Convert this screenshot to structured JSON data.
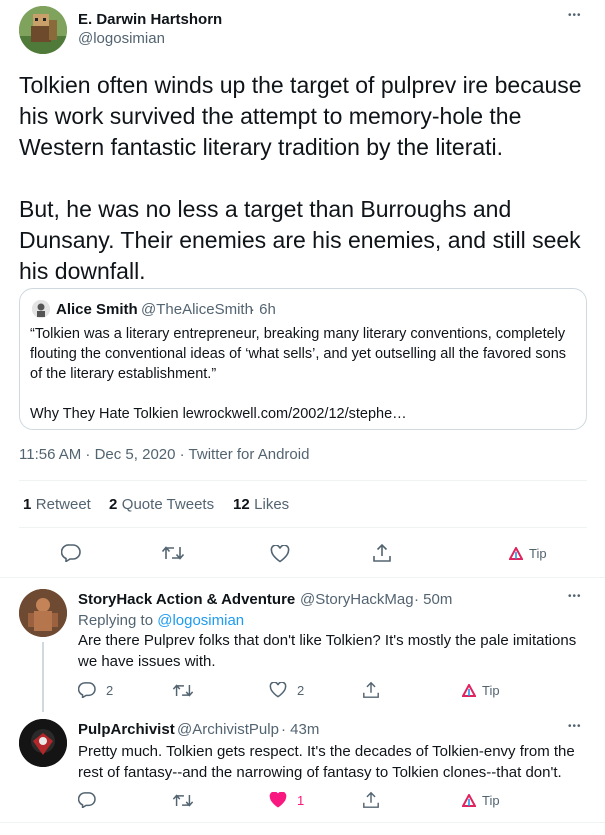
{
  "tweet": {
    "author_name": "E. Darwin Hartshorn",
    "author_handle": "@logosimian",
    "text": "Tolkien often winds up the target of pulprev ire because his work survived the attempt to memory-hole the Western fantastic literary tradition by the literati.\n\nBut, he was no less a target than Burroughs and Dunsany. Their enemies are his enemies, and still seek his downfall.",
    "more_glyph": "•••",
    "quote": {
      "name": "Alice Smith",
      "handle": "@TheAliceSmith",
      "time": "· 6h",
      "text": "“Tolkien was a literary entrepreneur, breaking many literary conventions, completely flouting the conventional ideas of ‘what sells’, and yet outselling all the favored sons of the literary establishment.”\n\nWhy They Hate Tolkien lewrockwell.com/2002/12/stephe…"
    },
    "timestamp": "11:56 AM · Dec 5, 2020 · Twitter for Android",
    "stats": {
      "retweets_num": "1",
      "retweets_label": "Retweet",
      "quotes_num": "2",
      "quotes_label": "Quote Tweets",
      "likes_num": "12",
      "likes_label": "Likes"
    },
    "tip_label": "Tip",
    "colors": {
      "accent": "#1d9bf0",
      "like": "#f91880",
      "tip": "#e0245e"
    }
  },
  "replies": [
    {
      "name": "StoryHack Action & Adventure",
      "handle": "@StoryHackMag",
      "time": "· 50m",
      "replying_to_prefix": "Replying to",
      "replying_to": "@logosimian",
      "text": "Are there Pulprev folks that don't like Tolkien? It's mostly the pale imitations we have issues with.",
      "reply_count": "2",
      "like_count": "2",
      "tip_label": "Tip"
    },
    {
      "name": "PulpArchivist",
      "handle": "@ArchivistPulp",
      "time": "· 43m",
      "text": "Pretty much. Tolkien gets respect. It's the decades of Tolkien-envy from the rest of fantasy--and the narrowing of fantasy to Tolkien clones--that don't.",
      "like_count": "1",
      "tip_label": "Tip"
    }
  ]
}
